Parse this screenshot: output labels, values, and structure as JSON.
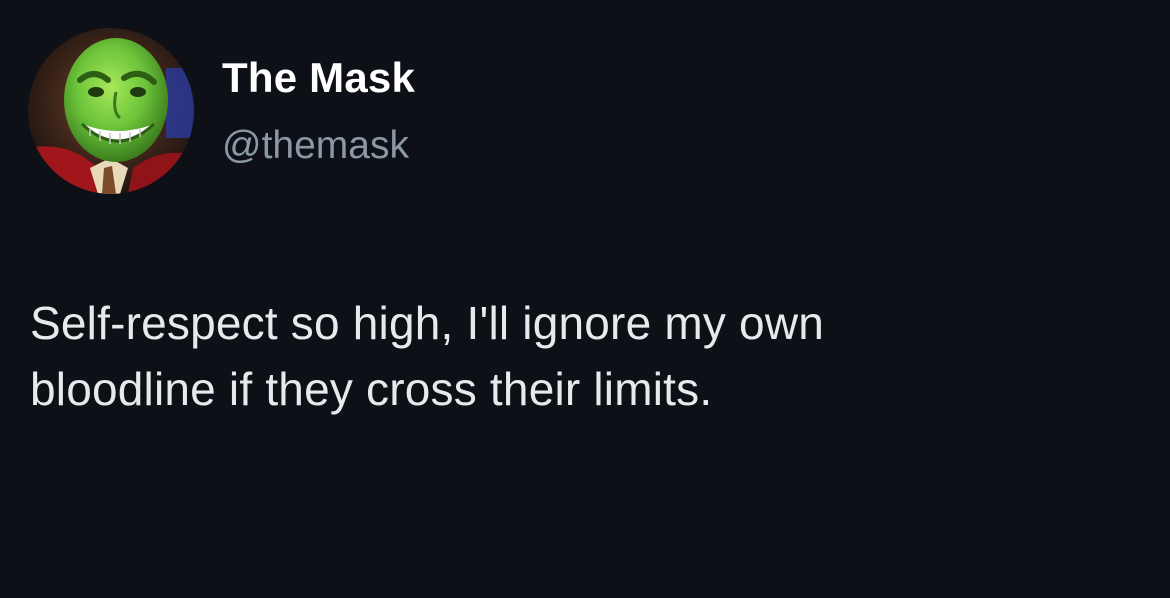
{
  "tweet": {
    "author": {
      "display_name": "The Mask",
      "handle": "@themask",
      "avatar_icon": "green-mask-face-avatar"
    },
    "text_lines": [
      "Self-respect so high, I'll ignore my own",
      "bloodline if they cross their limits."
    ]
  },
  "colors": {
    "background": "#0d1016",
    "name": "#ffffff",
    "handle": "#8b98a5",
    "text": "#e7e9ea"
  }
}
